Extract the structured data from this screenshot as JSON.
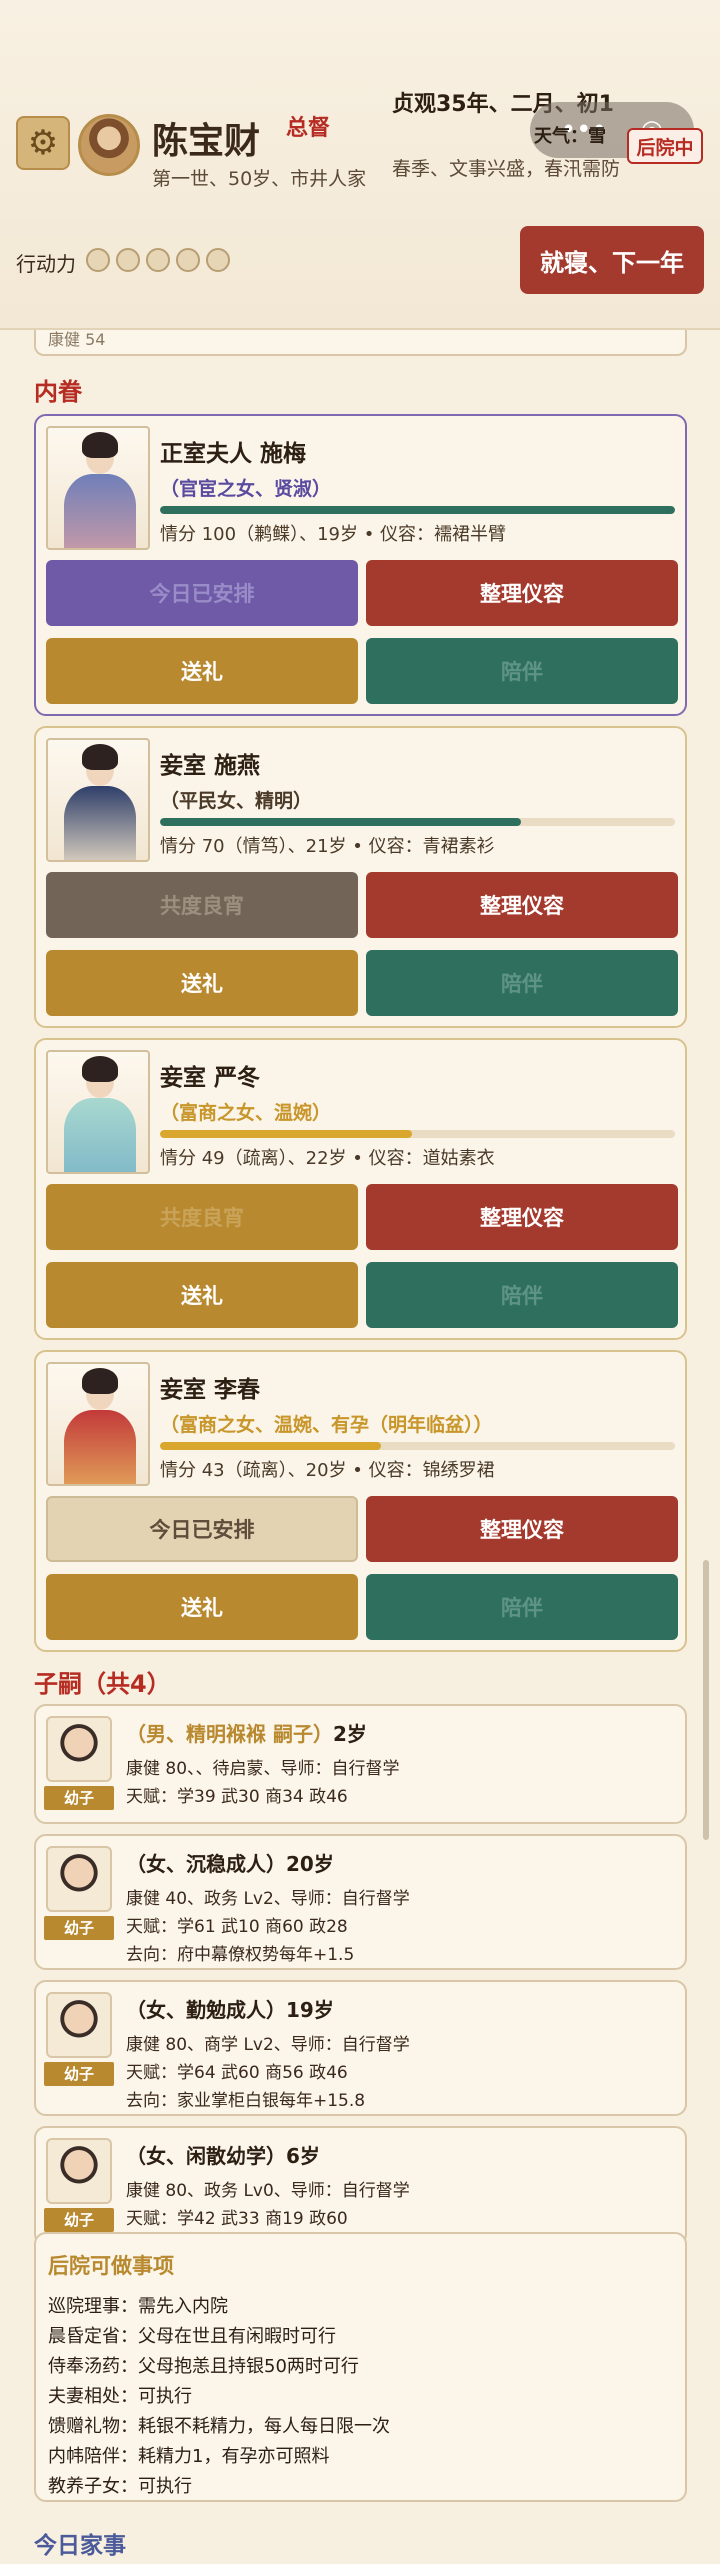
{
  "header": {
    "gear_icon": "gear-icon",
    "name": "陈宝财",
    "rank": "总督",
    "subtitle": "第一世、50岁、市井人家",
    "date": "贞观35年、二月、初1",
    "weather": "天气：雪",
    "season": "春季、文事兴盛，春汛需防",
    "houyuan_label": "后院中",
    "capsule_more": "•••",
    "capsule_record": "◎",
    "action_power_label": "行动力",
    "action_power_total": 5,
    "sleep_button": "就寝、下一年"
  },
  "previous_card_text": "康健 54",
  "harem": {
    "title": "内眷",
    "spouses": [
      {
        "title": "正室夫人 施梅",
        "traits": "（官宦之女、贤淑）",
        "affection": 100,
        "bar_color": "#2f6f5e",
        "trait_color": "#5a4aa0",
        "info": "情分 100（鹣鲽）、19岁 • 仪容：襦裙半臂",
        "actions": [
          "今日已安排",
          "整理仪容",
          "送礼",
          "陪伴"
        ]
      },
      {
        "title": "妾室 施燕",
        "traits": "（平民女、精明）",
        "affection": 70,
        "bar_color": "#2f6f5e",
        "trait_color": "#4b3a28",
        "info": "情分 70（情笃）、21岁 • 仪容：青裙素衫",
        "actions": [
          "共度良宵",
          "整理仪容",
          "送礼",
          "陪伴"
        ]
      },
      {
        "title": "妾室 严冬",
        "traits": "（富商之女、温婉）",
        "affection": 49,
        "bar_color": "#d9a62e",
        "trait_color": "#c8962a",
        "info": "情分 49（疏离）、22岁 • 仪容：道姑素衣",
        "actions": [
          "共度良宵",
          "整理仪容",
          "送礼",
          "陪伴"
        ]
      },
      {
        "title": "妾室 李春",
        "traits": "（富商之女、温婉、有孕（明年临盆））",
        "affection": 43,
        "bar_color": "#d9a62e",
        "trait_color": "#c8962a",
        "info": "情分 43（疏离）、20岁 • 仪容：锦绣罗裙",
        "actions": [
          "今日已安排",
          "整理仪容",
          "送礼",
          "陪伴"
        ]
      }
    ]
  },
  "children": {
    "title": "子嗣（共4）",
    "items": [
      {
        "badge": "幼子",
        "line1_gold": "（男、精明褓褓 嗣子）",
        "line1_rest": "2岁",
        "lines": [
          "康健 80、、待启蒙、导师：自行督学",
          "天赋：学39 武30 商34 政46"
        ]
      },
      {
        "badge": "幼子",
        "line1_gold": "",
        "line1_rest": "（女、沉稳成人）20岁",
        "lines": [
          "康健 40、政务 Lv2、导师：自行督学",
          "天赋：学61 武10 商60 政28",
          "去向：府中幕僚权势每年+1.5"
        ]
      },
      {
        "badge": "幼子",
        "line1_gold": "",
        "line1_rest": "（女、勤勉成人）19岁",
        "lines": [
          "康健 80、商学 Lv2、导师：自行督学",
          "天赋：学64 武60 商56 政46",
          "去向：家业掌柜白银每年+15.8"
        ]
      },
      {
        "badge": "幼子",
        "line1_gold": "",
        "line1_rest": "（女、闲散幼学）6岁",
        "lines": [
          "康健 80、政务 Lv0、导师：自行督学",
          "天赋：学42 武33 商19 政60"
        ]
      }
    ]
  },
  "tasks": {
    "title": "后院可做事项",
    "items": [
      "巡院理事：需先入内院",
      "晨昏定省：父母在世且有闲暇时可行",
      "侍奉汤药：父母抱恙且持银50两时可行",
      "夫妻相处：可执行",
      "馈赠礼物：耗银不耗精力，每人每日限一次",
      "内帏陪伴：耗精力1，有孕亦可照料",
      "教养子女：可执行"
    ]
  },
  "today": {
    "title": "今日家事"
  }
}
